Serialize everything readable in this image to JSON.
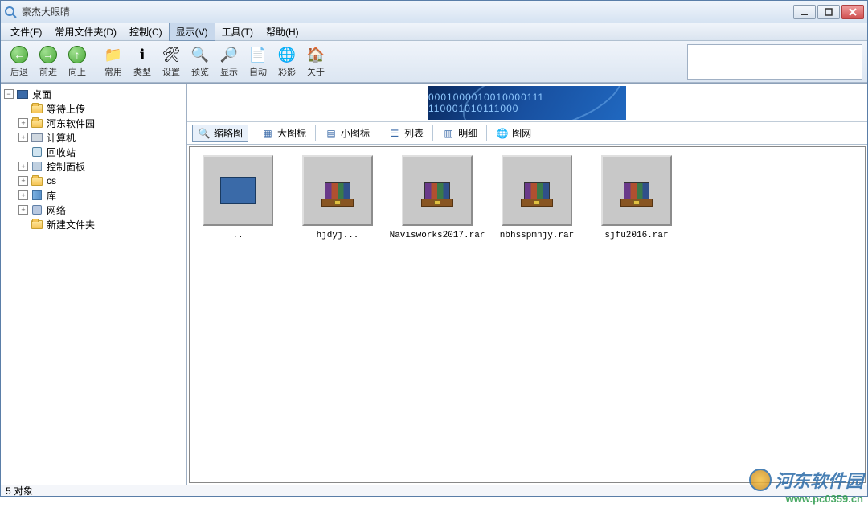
{
  "window": {
    "title": "豪杰大眼睛"
  },
  "menubar": [
    {
      "label": "文件(F)"
    },
    {
      "label": "常用文件夹(D)"
    },
    {
      "label": "控制(C)"
    },
    {
      "label": "显示(V)",
      "active": true
    },
    {
      "label": "工具(T)"
    },
    {
      "label": "帮助(H)"
    }
  ],
  "toolbar": [
    {
      "name": "back-button",
      "label": "后退",
      "icon": "←",
      "style": "green"
    },
    {
      "name": "forward-button",
      "label": "前进",
      "icon": "→",
      "style": "green"
    },
    {
      "name": "up-button",
      "label": "向上",
      "icon": "↑",
      "style": "green"
    },
    {
      "sep": true
    },
    {
      "name": "common-button",
      "label": "常用",
      "icon": "📁"
    },
    {
      "name": "type-button",
      "label": "类型",
      "icon": "ℹ"
    },
    {
      "name": "settings-button",
      "label": "设置",
      "icon": "🛠"
    },
    {
      "name": "preview-button",
      "label": "预览",
      "icon": "🔍"
    },
    {
      "name": "show-button",
      "label": "显示",
      "icon": "🔎"
    },
    {
      "name": "auto-button",
      "label": "自动",
      "icon": "📄"
    },
    {
      "name": "color-button",
      "label": "彩影",
      "icon": "🌐"
    },
    {
      "name": "about-button",
      "label": "关于",
      "icon": "🏠"
    }
  ],
  "tree": {
    "root": {
      "label": "桌面",
      "icon": "desktop"
    },
    "children": [
      {
        "label": "等待上传",
        "icon": "folder",
        "toggle": null
      },
      {
        "label": "河东软件园",
        "icon": "folder",
        "toggle": "+"
      },
      {
        "label": "计算机",
        "icon": "computer",
        "toggle": "+"
      },
      {
        "label": "回收站",
        "icon": "recycle",
        "toggle": null
      },
      {
        "label": "控制面板",
        "icon": "control",
        "toggle": "+"
      },
      {
        "label": "cs",
        "icon": "folder",
        "toggle": "+"
      },
      {
        "label": "库",
        "icon": "library",
        "toggle": "+"
      },
      {
        "label": "网络",
        "icon": "network",
        "toggle": "+"
      },
      {
        "label": "新建文件夹",
        "icon": "folder",
        "toggle": null
      }
    ]
  },
  "banner_text": "0001000010010000111  110001010111000",
  "view_tabs": [
    {
      "name": "thumbnail-tab",
      "label": "缩略图",
      "active": true
    },
    {
      "name": "large-icon-tab",
      "label": "大图标"
    },
    {
      "name": "small-icon-tab",
      "label": "小图标"
    },
    {
      "name": "list-tab",
      "label": "列表"
    },
    {
      "name": "detail-tab",
      "label": "明细"
    },
    {
      "name": "web-tab",
      "label": "图网"
    }
  ],
  "thumbnails": [
    {
      "label": "..",
      "type": "desktop"
    },
    {
      "label": "hjdyj...",
      "type": "rar"
    },
    {
      "label": "Navisworks2017.rar",
      "type": "rar"
    },
    {
      "label": "nbhsspmnjy.rar",
      "type": "rar"
    },
    {
      "label": "sjfu2016.rar",
      "type": "rar"
    }
  ],
  "statusbar": {
    "text": "5 对象"
  },
  "watermark": {
    "line1": "河东软件园",
    "line2": "www.pc0359.cn"
  }
}
